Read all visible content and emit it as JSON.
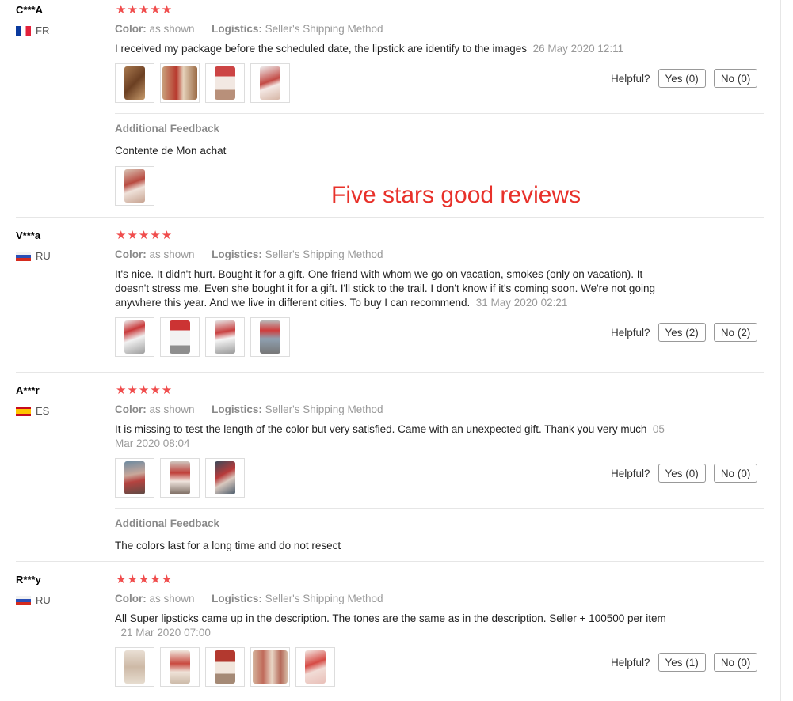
{
  "overlay_text": "Five stars good reviews",
  "labels": {
    "color": "Color:",
    "logistics": "Logistics:",
    "helpful": "Helpful?",
    "additional_feedback": "Additional Feedback"
  },
  "star_glyphs": "★★★★★",
  "reviews": [
    {
      "user": "C***A",
      "country": "FR",
      "rating": 5,
      "color_value": "as shown",
      "logistics_value": "Seller's Shipping Method",
      "text": "I received my package before the scheduled date, the lipstick are identify to the images",
      "date": "26 May 2020 12:11",
      "yes": "Yes (0)",
      "no": "No (0)",
      "additional_text": "Contente de Mon achat"
    },
    {
      "user": "V***a",
      "country": "RU",
      "rating": 5,
      "color_value": "as shown",
      "logistics_value": "Seller's Shipping Method",
      "text": "It's nice. It didn't hurt. Bought it for a gift. One friend with whom we go on vacation, smokes (only on vacation). It doesn't stress me. Even she bought it for a gift. I'll stick to the trail. I don't know if it's coming soon. We're not going anywhere this year. And we live in different cities. To buy I can recommend.",
      "date": "31 May 2020 02:21",
      "yes": "Yes (2)",
      "no": "No (2)"
    },
    {
      "user": "A***r",
      "country": "ES",
      "rating": 5,
      "color_value": "as shown",
      "logistics_value": "Seller's Shipping Method",
      "text": "It is missing to test the length of the color but very satisfied. Came with an unexpected gift. Thank you very much",
      "date": "05 Mar 2020 08:04",
      "yes": "Yes (0)",
      "no": "No (0)",
      "additional_text": "The colors last for a long time and do not resect"
    },
    {
      "user": "R***y",
      "country": "RU",
      "rating": 5,
      "color_value": "as shown",
      "logistics_value": "Seller's Shipping Method",
      "text": "All Super lipsticks came up in the description. The tones are the same as in the description. Seller + 100500 per item",
      "date": "21 Mar 2020 07:00",
      "yes": "Yes (1)",
      "no": "No (0)"
    }
  ],
  "colors": {
    "star": "#f04d4d",
    "overlay": "#e8312a",
    "meta": "#999999"
  }
}
